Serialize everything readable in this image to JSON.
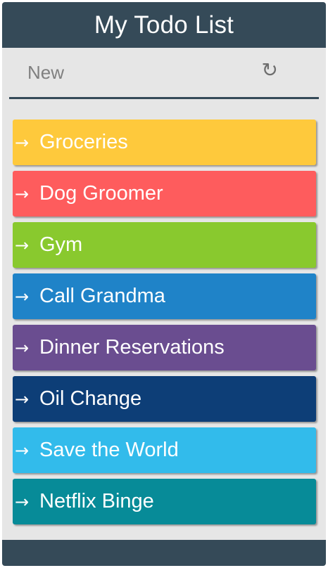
{
  "header": {
    "title": "My Todo List"
  },
  "new_item": {
    "placeholder": "New",
    "refresh_icon": "refresh-icon"
  },
  "todos": [
    {
      "label": "Groceries",
      "color": "#fec93c"
    },
    {
      "label": "Dog Groomer",
      "color": "#fe5c5d"
    },
    {
      "label": "Gym",
      "color": "#89c92e"
    },
    {
      "label": "Call Grandma",
      "color": "#1f83c8"
    },
    {
      "label": "Dinner Reservations",
      "color": "#6a4d90"
    },
    {
      "label": "Oil Change",
      "color": "#0d3e77"
    },
    {
      "label": "Save the World",
      "color": "#32bbeb"
    },
    {
      "label": "Netflix Binge",
      "color": "#078b98"
    }
  ],
  "arrow_symbol": "→"
}
